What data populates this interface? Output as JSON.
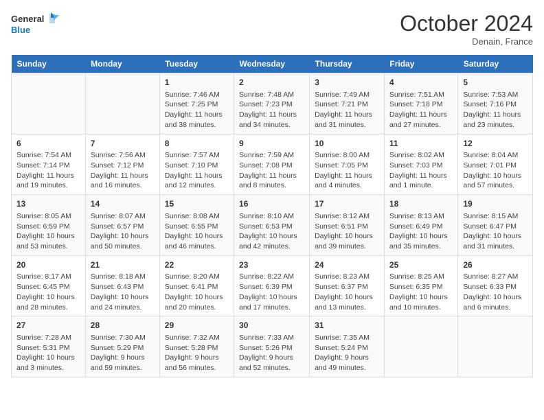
{
  "header": {
    "logo_text_general": "General",
    "logo_text_blue": "Blue",
    "month_title": "October 2024",
    "location": "Denain, France"
  },
  "calendar": {
    "days_of_week": [
      "Sunday",
      "Monday",
      "Tuesday",
      "Wednesday",
      "Thursday",
      "Friday",
      "Saturday"
    ],
    "weeks": [
      [
        {
          "day": "",
          "sunrise": "",
          "sunset": "",
          "daylight": ""
        },
        {
          "day": "",
          "sunrise": "",
          "sunset": "",
          "daylight": ""
        },
        {
          "day": "1",
          "sunrise": "Sunrise: 7:46 AM",
          "sunset": "Sunset: 7:25 PM",
          "daylight": "Daylight: 11 hours and 38 minutes."
        },
        {
          "day": "2",
          "sunrise": "Sunrise: 7:48 AM",
          "sunset": "Sunset: 7:23 PM",
          "daylight": "Daylight: 11 hours and 34 minutes."
        },
        {
          "day": "3",
          "sunrise": "Sunrise: 7:49 AM",
          "sunset": "Sunset: 7:21 PM",
          "daylight": "Daylight: 11 hours and 31 minutes."
        },
        {
          "day": "4",
          "sunrise": "Sunrise: 7:51 AM",
          "sunset": "Sunset: 7:18 PM",
          "daylight": "Daylight: 11 hours and 27 minutes."
        },
        {
          "day": "5",
          "sunrise": "Sunrise: 7:53 AM",
          "sunset": "Sunset: 7:16 PM",
          "daylight": "Daylight: 11 hours and 23 minutes."
        }
      ],
      [
        {
          "day": "6",
          "sunrise": "Sunrise: 7:54 AM",
          "sunset": "Sunset: 7:14 PM",
          "daylight": "Daylight: 11 hours and 19 minutes."
        },
        {
          "day": "7",
          "sunrise": "Sunrise: 7:56 AM",
          "sunset": "Sunset: 7:12 PM",
          "daylight": "Daylight: 11 hours and 16 minutes."
        },
        {
          "day": "8",
          "sunrise": "Sunrise: 7:57 AM",
          "sunset": "Sunset: 7:10 PM",
          "daylight": "Daylight: 11 hours and 12 minutes."
        },
        {
          "day": "9",
          "sunrise": "Sunrise: 7:59 AM",
          "sunset": "Sunset: 7:08 PM",
          "daylight": "Daylight: 11 hours and 8 minutes."
        },
        {
          "day": "10",
          "sunrise": "Sunrise: 8:00 AM",
          "sunset": "Sunset: 7:05 PM",
          "daylight": "Daylight: 11 hours and 4 minutes."
        },
        {
          "day": "11",
          "sunrise": "Sunrise: 8:02 AM",
          "sunset": "Sunset: 7:03 PM",
          "daylight": "Daylight: 11 hours and 1 minute."
        },
        {
          "day": "12",
          "sunrise": "Sunrise: 8:04 AM",
          "sunset": "Sunset: 7:01 PM",
          "daylight": "Daylight: 10 hours and 57 minutes."
        }
      ],
      [
        {
          "day": "13",
          "sunrise": "Sunrise: 8:05 AM",
          "sunset": "Sunset: 6:59 PM",
          "daylight": "Daylight: 10 hours and 53 minutes."
        },
        {
          "day": "14",
          "sunrise": "Sunrise: 8:07 AM",
          "sunset": "Sunset: 6:57 PM",
          "daylight": "Daylight: 10 hours and 50 minutes."
        },
        {
          "day": "15",
          "sunrise": "Sunrise: 8:08 AM",
          "sunset": "Sunset: 6:55 PM",
          "daylight": "Daylight: 10 hours and 46 minutes."
        },
        {
          "day": "16",
          "sunrise": "Sunrise: 8:10 AM",
          "sunset": "Sunset: 6:53 PM",
          "daylight": "Daylight: 10 hours and 42 minutes."
        },
        {
          "day": "17",
          "sunrise": "Sunrise: 8:12 AM",
          "sunset": "Sunset: 6:51 PM",
          "daylight": "Daylight: 10 hours and 39 minutes."
        },
        {
          "day": "18",
          "sunrise": "Sunrise: 8:13 AM",
          "sunset": "Sunset: 6:49 PM",
          "daylight": "Daylight: 10 hours and 35 minutes."
        },
        {
          "day": "19",
          "sunrise": "Sunrise: 8:15 AM",
          "sunset": "Sunset: 6:47 PM",
          "daylight": "Daylight: 10 hours and 31 minutes."
        }
      ],
      [
        {
          "day": "20",
          "sunrise": "Sunrise: 8:17 AM",
          "sunset": "Sunset: 6:45 PM",
          "daylight": "Daylight: 10 hours and 28 minutes."
        },
        {
          "day": "21",
          "sunrise": "Sunrise: 8:18 AM",
          "sunset": "Sunset: 6:43 PM",
          "daylight": "Daylight: 10 hours and 24 minutes."
        },
        {
          "day": "22",
          "sunrise": "Sunrise: 8:20 AM",
          "sunset": "Sunset: 6:41 PM",
          "daylight": "Daylight: 10 hours and 20 minutes."
        },
        {
          "day": "23",
          "sunrise": "Sunrise: 8:22 AM",
          "sunset": "Sunset: 6:39 PM",
          "daylight": "Daylight: 10 hours and 17 minutes."
        },
        {
          "day": "24",
          "sunrise": "Sunrise: 8:23 AM",
          "sunset": "Sunset: 6:37 PM",
          "daylight": "Daylight: 10 hours and 13 minutes."
        },
        {
          "day": "25",
          "sunrise": "Sunrise: 8:25 AM",
          "sunset": "Sunset: 6:35 PM",
          "daylight": "Daylight: 10 hours and 10 minutes."
        },
        {
          "day": "26",
          "sunrise": "Sunrise: 8:27 AM",
          "sunset": "Sunset: 6:33 PM",
          "daylight": "Daylight: 10 hours and 6 minutes."
        }
      ],
      [
        {
          "day": "27",
          "sunrise": "Sunrise: 7:28 AM",
          "sunset": "Sunset: 5:31 PM",
          "daylight": "Daylight: 10 hours and 3 minutes."
        },
        {
          "day": "28",
          "sunrise": "Sunrise: 7:30 AM",
          "sunset": "Sunset: 5:29 PM",
          "daylight": "Daylight: 9 hours and 59 minutes."
        },
        {
          "day": "29",
          "sunrise": "Sunrise: 7:32 AM",
          "sunset": "Sunset: 5:28 PM",
          "daylight": "Daylight: 9 hours and 56 minutes."
        },
        {
          "day": "30",
          "sunrise": "Sunrise: 7:33 AM",
          "sunset": "Sunset: 5:26 PM",
          "daylight": "Daylight: 9 hours and 52 minutes."
        },
        {
          "day": "31",
          "sunrise": "Sunrise: 7:35 AM",
          "sunset": "Sunset: 5:24 PM",
          "daylight": "Daylight: 9 hours and 49 minutes."
        },
        {
          "day": "",
          "sunrise": "",
          "sunset": "",
          "daylight": ""
        },
        {
          "day": "",
          "sunrise": "",
          "sunset": "",
          "daylight": ""
        }
      ]
    ]
  }
}
